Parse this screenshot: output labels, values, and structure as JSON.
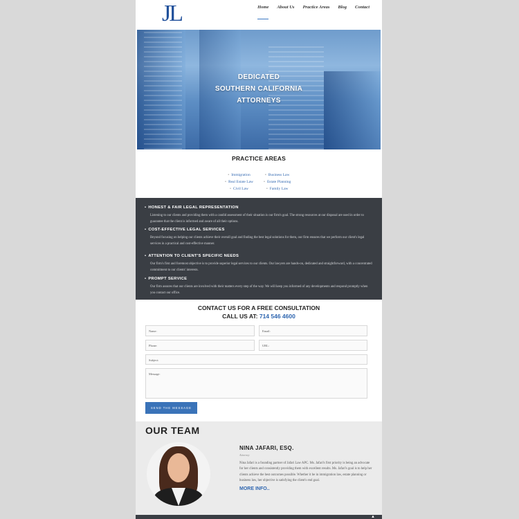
{
  "header": {
    "logo": "JL",
    "nav": [
      "Home",
      "About Us",
      "Practice Areas",
      "Blog",
      "Contact"
    ]
  },
  "hero": {
    "lines": [
      "DEDICATED",
      "SOUTHERN CALIFORNIA",
      "ATTORNEYS"
    ]
  },
  "practice": {
    "title": "PRACTICE AREAS",
    "left": [
      "Immigration",
      "Real Estate Law",
      "Civil Law"
    ],
    "right": [
      "Business Law",
      "Estate Planning",
      "Family Law"
    ]
  },
  "features": [
    {
      "title": "HONEST & FAIR LEGAL REPRESENTATION",
      "text": "Listening to our clients and providing them with a candid assessment of their situation is our firm's goal. The strong resources at our disposal are used in order to guarantee that the client is informed and aware of all their options."
    },
    {
      "title": "COST-EFFECTIVE LEGAL SERVICES",
      "text": "Beyond focusing on helping our clients achieve their overall goal and finding the best legal solutions for them, our firm ensures that we perform our client's legal services in a practical and cost-effective manner."
    },
    {
      "title": "ATTENTION TO CLIENT'S SPECIFIC NEEDS",
      "text": "Our firm's first and foremost objective is to provide superior legal services to our clients. Our lawyers are hands-on, dedicated and straightforward, with a concentrated commitment to our clients' interests."
    },
    {
      "title": "PROMPT SERVICE",
      "text": "Our firm assures that our clients are involved with their matters every step of the way. We will keep you informed of any developments and respond promptly when you contact our office."
    }
  ],
  "contact": {
    "title": "CONTACT US FOR A FREE CONSULTATION",
    "call_label": "CALL US AT:",
    "phone": "714 546 4600",
    "fields": {
      "name": "Name:",
      "email": "Email:",
      "phone": "Phone:",
      "url": "URL:",
      "subject": "Subject:",
      "message": "Message:"
    },
    "button": "SEND THE MESSAGE"
  },
  "team": {
    "title": "OUR TEAM",
    "member": {
      "name": "NINA JAFARI, ESQ.",
      "role": "Attorney",
      "bio": "Nina Jafari is a founding partner of Jafari Law APC. Ms. Jafari's first priority is being an advocate for her clients and consistently providing them with excellent results. Ms. Jafari's goal is to help her clients achieve the best outcomes possible. Whether it be in immigration law, estate planning or business law, her objective is satisfying the client's end goal.",
      "more": "MORE INFO.."
    }
  }
}
